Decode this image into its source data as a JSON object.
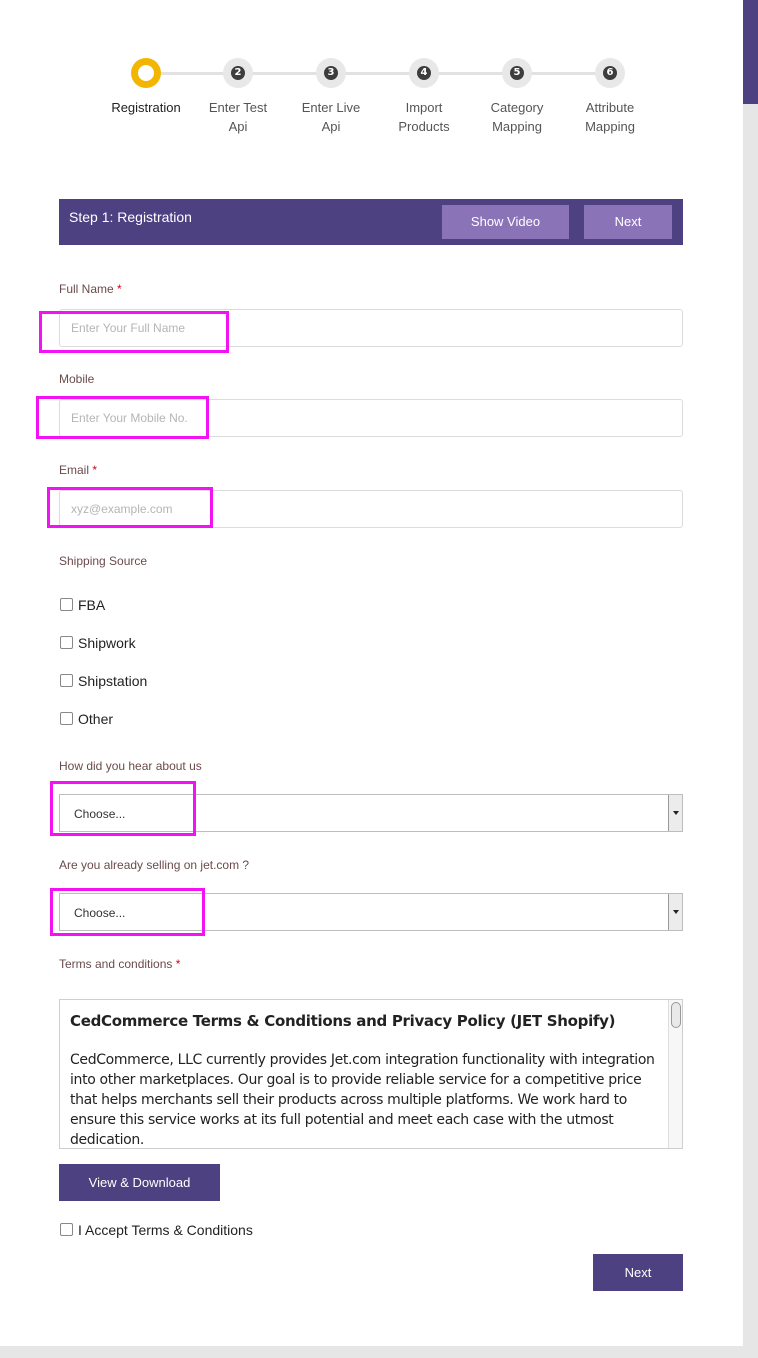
{
  "stepper": {
    "steps": [
      {
        "number": "",
        "label_line1": "Registration",
        "label_line2": ""
      },
      {
        "number": "2",
        "label_line1": "Enter Test",
        "label_line2": "Api"
      },
      {
        "number": "3",
        "label_line1": "Enter Live",
        "label_line2": "Api"
      },
      {
        "number": "4",
        "label_line1": "Import",
        "label_line2": "Products"
      },
      {
        "number": "5",
        "label_line1": "Category",
        "label_line2": "Mapping"
      },
      {
        "number": "6",
        "label_line1": "Attribute",
        "label_line2": "Mapping"
      }
    ],
    "active_index": 0,
    "active_color": "#f3b600"
  },
  "header": {
    "title": "Step 1: Registration",
    "show_video_label": "Show Video",
    "next_label": "Next",
    "bg_color": "#4d4182"
  },
  "form": {
    "full_name": {
      "label": "Full Name",
      "required_mark": "*",
      "placeholder": "Enter Your Full Name",
      "value": ""
    },
    "mobile": {
      "label": "Mobile",
      "placeholder": "Enter Your Mobile No.",
      "value": ""
    },
    "email": {
      "label": "Email",
      "required_mark": "*",
      "placeholder": "xyz@example.com",
      "value": ""
    },
    "shipping_source": {
      "label": "Shipping Source",
      "options": [
        "FBA",
        "Shipwork",
        "Shipstation",
        "Other"
      ]
    },
    "heard_about": {
      "label": "How did you hear about us",
      "selected": "Choose..."
    },
    "selling_on_jet": {
      "label": "Are you already selling on jet.com ?",
      "selected": "Choose..."
    },
    "terms": {
      "label": "Terms and conditions",
      "required_mark": "*",
      "title": "CedCommerce Terms & Conditions and Privacy Policy (JET Shopify)",
      "body": "CedCommerce, LLC currently provides Jet.com integration functionality with integration into other marketplaces. Our goal is to provide reliable service for a competitive price that helps merchants sell their products across multiple platforms. We work hard to ensure this service works at its full potential and meet each case with the utmost dedication.",
      "view_download_label": "View & Download",
      "accept_label": "I Accept Terms & Conditions"
    },
    "next_label": "Next"
  },
  "highlight_color": "#f312f3"
}
